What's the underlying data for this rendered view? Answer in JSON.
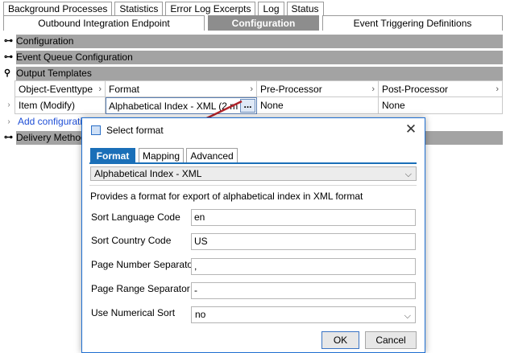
{
  "top_tabs_row1": [
    {
      "label": "Background Processes"
    },
    {
      "label": "Statistics"
    },
    {
      "label": "Error Log Excerpts"
    },
    {
      "label": "Log"
    },
    {
      "label": "Status"
    }
  ],
  "top_tabs_row2": [
    {
      "label": "Outbound Integration Endpoint",
      "active": false
    },
    {
      "label": "Configuration",
      "active": true
    },
    {
      "label": "Event Triggering Definitions",
      "active": false
    }
  ],
  "sections": {
    "configuration": "Configuration",
    "event_queue": "Event Queue Configuration",
    "output_templates": "Output Templates",
    "delivery_method": "Delivery Method"
  },
  "grid": {
    "headers": [
      "Object-Eventtype",
      "Format",
      "Pre-Processor",
      "Post-Processor"
    ],
    "row": {
      "object": "Item (Modify)",
      "format": "Alphabetical Index - XML (2 m",
      "pre": "None",
      "post": "None"
    },
    "ellipsis": "...",
    "add_link": "Add configuration"
  },
  "dialog": {
    "title": "Select format",
    "close_glyph": "✕",
    "tabs": [
      {
        "label": "Format",
        "active": true
      },
      {
        "label": "Mapping",
        "active": false
      },
      {
        "label": "Advanced",
        "active": false
      }
    ],
    "format_select": "Alphabetical Index - XML",
    "description": "Provides a format for export of alphabetical index in XML format",
    "fields": [
      {
        "label": "Sort Language Code",
        "value": "en"
      },
      {
        "label": "Sort Country Code",
        "value": "US"
      },
      {
        "label": "Page Number Separator",
        "value": ","
      },
      {
        "label": "Page Range Separator",
        "value": "-"
      },
      {
        "label": "Use Numerical Sort",
        "value": "no"
      }
    ],
    "ok": "OK",
    "cancel": "Cancel"
  },
  "colors": {
    "active_tab": "#8d8d8d",
    "dialog_tab_active": "#1a6fb8",
    "section_bar": "#a3a3a3",
    "annotation_arrow": "#b0242a"
  },
  "icons": {
    "collapsed_section": "key-expand-icon",
    "expanded_section": "key-collapse-icon"
  }
}
